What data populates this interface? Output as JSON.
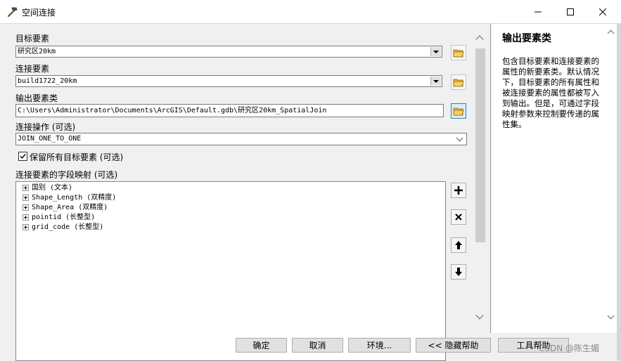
{
  "window": {
    "title": "空间连接",
    "icon": "hammer-icon",
    "controls": [
      "minimize-icon",
      "maximize-icon",
      "close-icon"
    ]
  },
  "form": {
    "target_label": "目标要素",
    "target_value": "研究区20km",
    "join_label": "连接要素",
    "join_value": "build1722_20km",
    "output_label": "输出要素类",
    "output_value": "C:\\Users\\Administrator\\Documents\\ArcGIS\\Default.gdb\\研究区20km_SpatialJoin",
    "operation_label": "连接操作 (可选)",
    "operation_value": "JOIN_ONE_TO_ONE",
    "keep_all_label": "保留所有目标要素 (可选)",
    "keep_all_checked": true,
    "fieldmap_label": "连接要素的字段映射 (可选)",
    "fields": [
      "国别 (文本)",
      "Shape_Length (双精度)",
      "Shape_Area (双精度)",
      "pointid (长整型)",
      "grid_code (长整型)"
    ]
  },
  "help": {
    "title": "输出要素类",
    "body": "包含目标要素和连接要素的属性的新要素类。默认情况下，目标要素的所有属性和被连接要素的属性都被写入到输出。但是，可通过字段映射参数来控制要传递的属性集。"
  },
  "buttons": {
    "ok": "确定",
    "cancel": "取消",
    "env": "环境...",
    "hide_help": "<< 隐藏帮助",
    "tool_help": "工具帮助"
  },
  "watermark": "CSDN @陈生媚",
  "colors": {
    "accent": "#3c7fb1",
    "window_bg": "#f0f0f0"
  }
}
